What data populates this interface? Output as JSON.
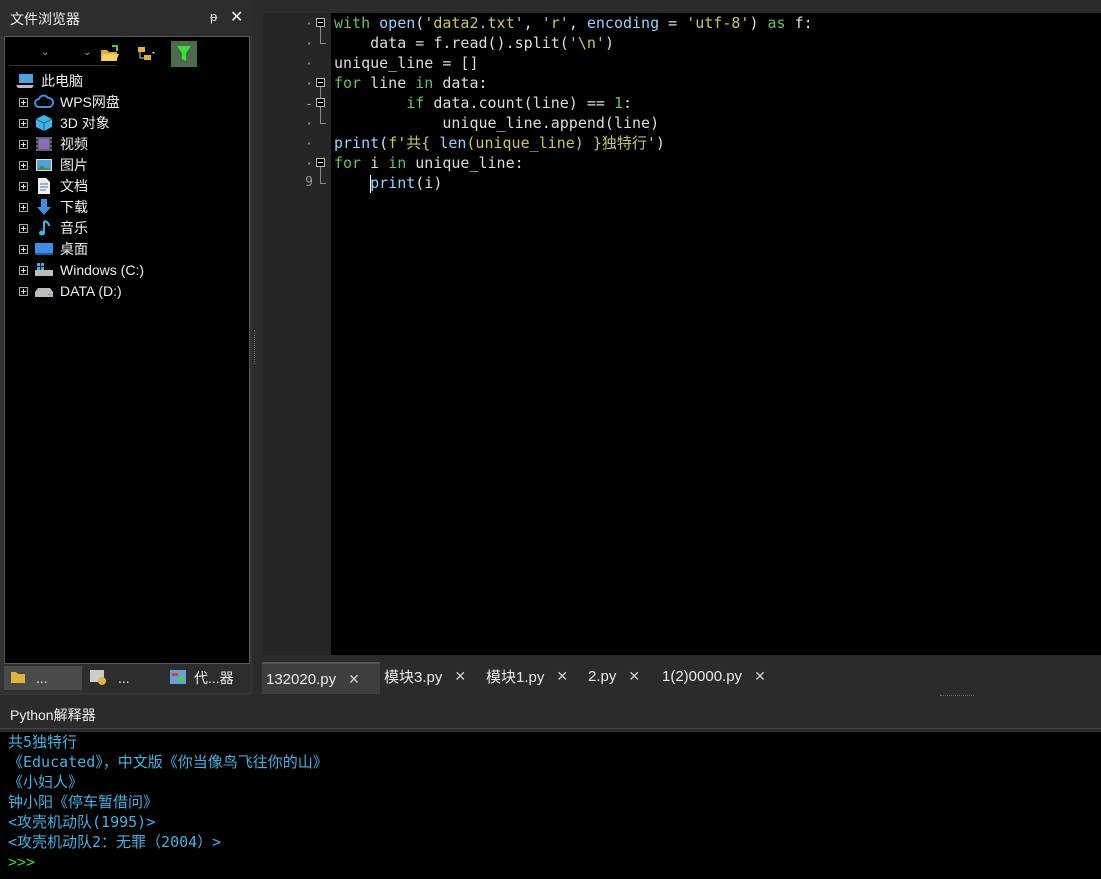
{
  "file_browser": {
    "title": "文件浏览器",
    "pin_glyph": "ᵽ",
    "close_glyph": "✕",
    "tree_root": "此电脑",
    "items": [
      {
        "label": "WPS网盘",
        "icon": "cloud-icon"
      },
      {
        "label": "3D 对象",
        "icon": "cube-3d-icon"
      },
      {
        "label": "视频",
        "icon": "video-icon"
      },
      {
        "label": "图片",
        "icon": "picture-icon"
      },
      {
        "label": "文档",
        "icon": "document-icon"
      },
      {
        "label": "下载",
        "icon": "download-arrow-icon"
      },
      {
        "label": "音乐",
        "icon": "music-note-icon"
      },
      {
        "label": "桌面",
        "icon": "desktop-icon"
      },
      {
        "label": "Windows (C:)",
        "icon": "windows-drive-icon"
      },
      {
        "label": "DATA (D:)",
        "icon": "drive-icon"
      }
    ],
    "bottom_tabs": [
      {
        "label": "...",
        "icon": "folder-icon"
      },
      {
        "label": "...",
        "icon": "package-icon"
      },
      {
        "label": "代...器",
        "icon": "code-browser-icon"
      }
    ]
  },
  "editor": {
    "line_number_shown": "9",
    "lines": [
      [
        [
          "kw",
          "with "
        ],
        [
          "id",
          "open"
        ],
        [
          "pl",
          "("
        ],
        [
          "st",
          "'data2.txt'"
        ],
        [
          "pl",
          ", "
        ],
        [
          "st",
          "'r'"
        ],
        [
          "pl",
          ", "
        ],
        [
          "id",
          "encoding"
        ],
        [
          "pl",
          " = "
        ],
        [
          "st",
          "'utf-8'"
        ],
        [
          "pl",
          ") "
        ],
        [
          "kw",
          "as "
        ],
        [
          "pl",
          "f:"
        ]
      ],
      [
        [
          "pl",
          "    data = f.read().split("
        ],
        [
          "st",
          "'\\n'"
        ],
        [
          "pl",
          ")"
        ]
      ],
      [
        [
          "pl",
          "unique_line = []"
        ]
      ],
      [
        [
          "kw",
          "for "
        ],
        [
          "pl",
          "line "
        ],
        [
          "kw",
          "in "
        ],
        [
          "pl",
          "data:"
        ]
      ],
      [
        [
          "pl",
          "        "
        ],
        [
          "kw",
          "if "
        ],
        [
          "pl",
          "data.count(line) == "
        ],
        [
          "nm",
          "1"
        ],
        [
          "pl",
          ":"
        ]
      ],
      [
        [
          "pl",
          "            unique_line.append(line)"
        ]
      ],
      [
        [
          "id",
          "print"
        ],
        [
          "pl",
          "("
        ],
        [
          "st",
          "f'共{ "
        ],
        [
          "id",
          "len"
        ],
        [
          "st",
          "(unique_line) }独特行'"
        ],
        [
          "pl",
          ")"
        ]
      ],
      [
        [
          "kw",
          "for "
        ],
        [
          "pl",
          "i "
        ],
        [
          "kw",
          "in "
        ],
        [
          "pl",
          "unique_line:"
        ]
      ],
      [
        [
          "pl",
          "    "
        ],
        [
          "id",
          "print"
        ],
        [
          "pl",
          "(i)"
        ]
      ]
    ]
  },
  "tabs": [
    {
      "label": "132020.py",
      "active": true
    },
    {
      "label": "模块3.py",
      "active": false
    },
    {
      "label": "模块1.py",
      "active": false
    },
    {
      "label": "2.py",
      "active": false
    },
    {
      "label": "1(2)0000.py",
      "active": false
    }
  ],
  "tab_close_glyph": "✕",
  "console": {
    "title": "Python解释器",
    "output": [
      "共5独特行",
      "《Educated》，中文版《你当像鸟飞往你的山》",
      "《小妇人》",
      "钟小阳《停车暂借问》",
      "<攻壳机动队(1995)>",
      "<攻壳机动队2：无罪（2004）>"
    ],
    "prompt": ">>>"
  },
  "colors": {
    "keyword": "#5ec65e",
    "string": "#c8c85a",
    "identifier": "#8fd4ff",
    "console_output": "#3cb4e6",
    "console_prompt": "#3cd23c"
  }
}
